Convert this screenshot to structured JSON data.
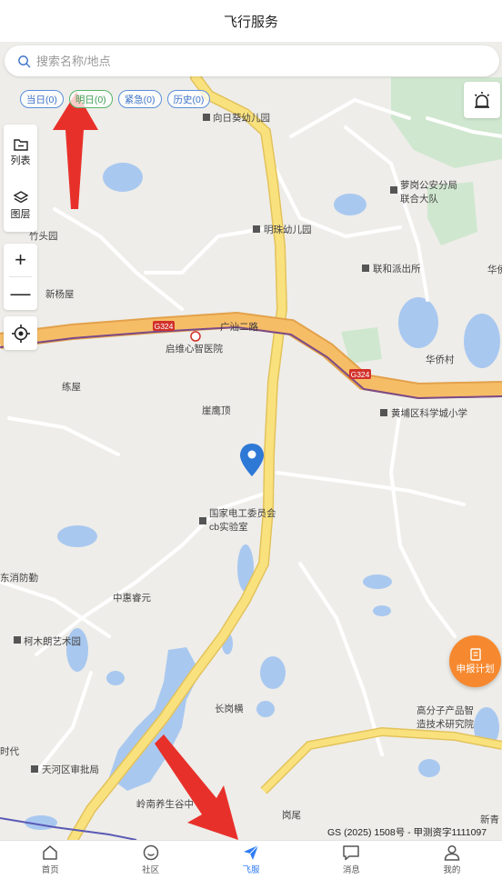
{
  "header": {
    "title": "飞行服务"
  },
  "search": {
    "placeholder": "搜索名称/地点"
  },
  "filters": [
    {
      "label": "当日(0)"
    },
    {
      "label": "明日(0)"
    },
    {
      "label": "紧急(0)"
    },
    {
      "label": "历史(0)"
    }
  ],
  "side_panel": {
    "list_label": "列表",
    "layers_label": "图层",
    "zoom_in": "+",
    "zoom_out": "—"
  },
  "map": {
    "road_label": "广汕二路",
    "shields": [
      "G324",
      "G324"
    ],
    "pois": [
      "向日葵幼儿园",
      "萝岗公安分局",
      "联合大队",
      "竹头园",
      "明珠幼儿园",
      "联和派出所",
      "新杨屋",
      "启维心智医院",
      "华侨村",
      "练屋",
      "黄埔区科学城小学",
      "崖鹰顶",
      "国家电工委员会",
      "cb实验室",
      "东消防勤",
      "中惠睿元",
      "柯木朗艺术园",
      "长岗横",
      "高分子产品智",
      "造技术研究院",
      "天河区审批局",
      "岭南养生谷中",
      "岗尾",
      "时代",
      "华侨",
      "新青"
    ],
    "attribution": "GS (2025) 1508号 - 甲测资字1111097"
  },
  "report_button": {
    "label": "申报计划"
  },
  "tabs": [
    {
      "label": "首页"
    },
    {
      "label": "社区"
    },
    {
      "label": "飞服"
    },
    {
      "label": "消息"
    },
    {
      "label": "我的"
    }
  ],
  "colors": {
    "accent": "#2e7cf6",
    "report": "#f6892f",
    "road_main": "#f7d66c",
    "highway": "#f4b45c",
    "water": "#a9c8f0",
    "green": "#cfe7cf",
    "arrow": "#e8302a"
  }
}
